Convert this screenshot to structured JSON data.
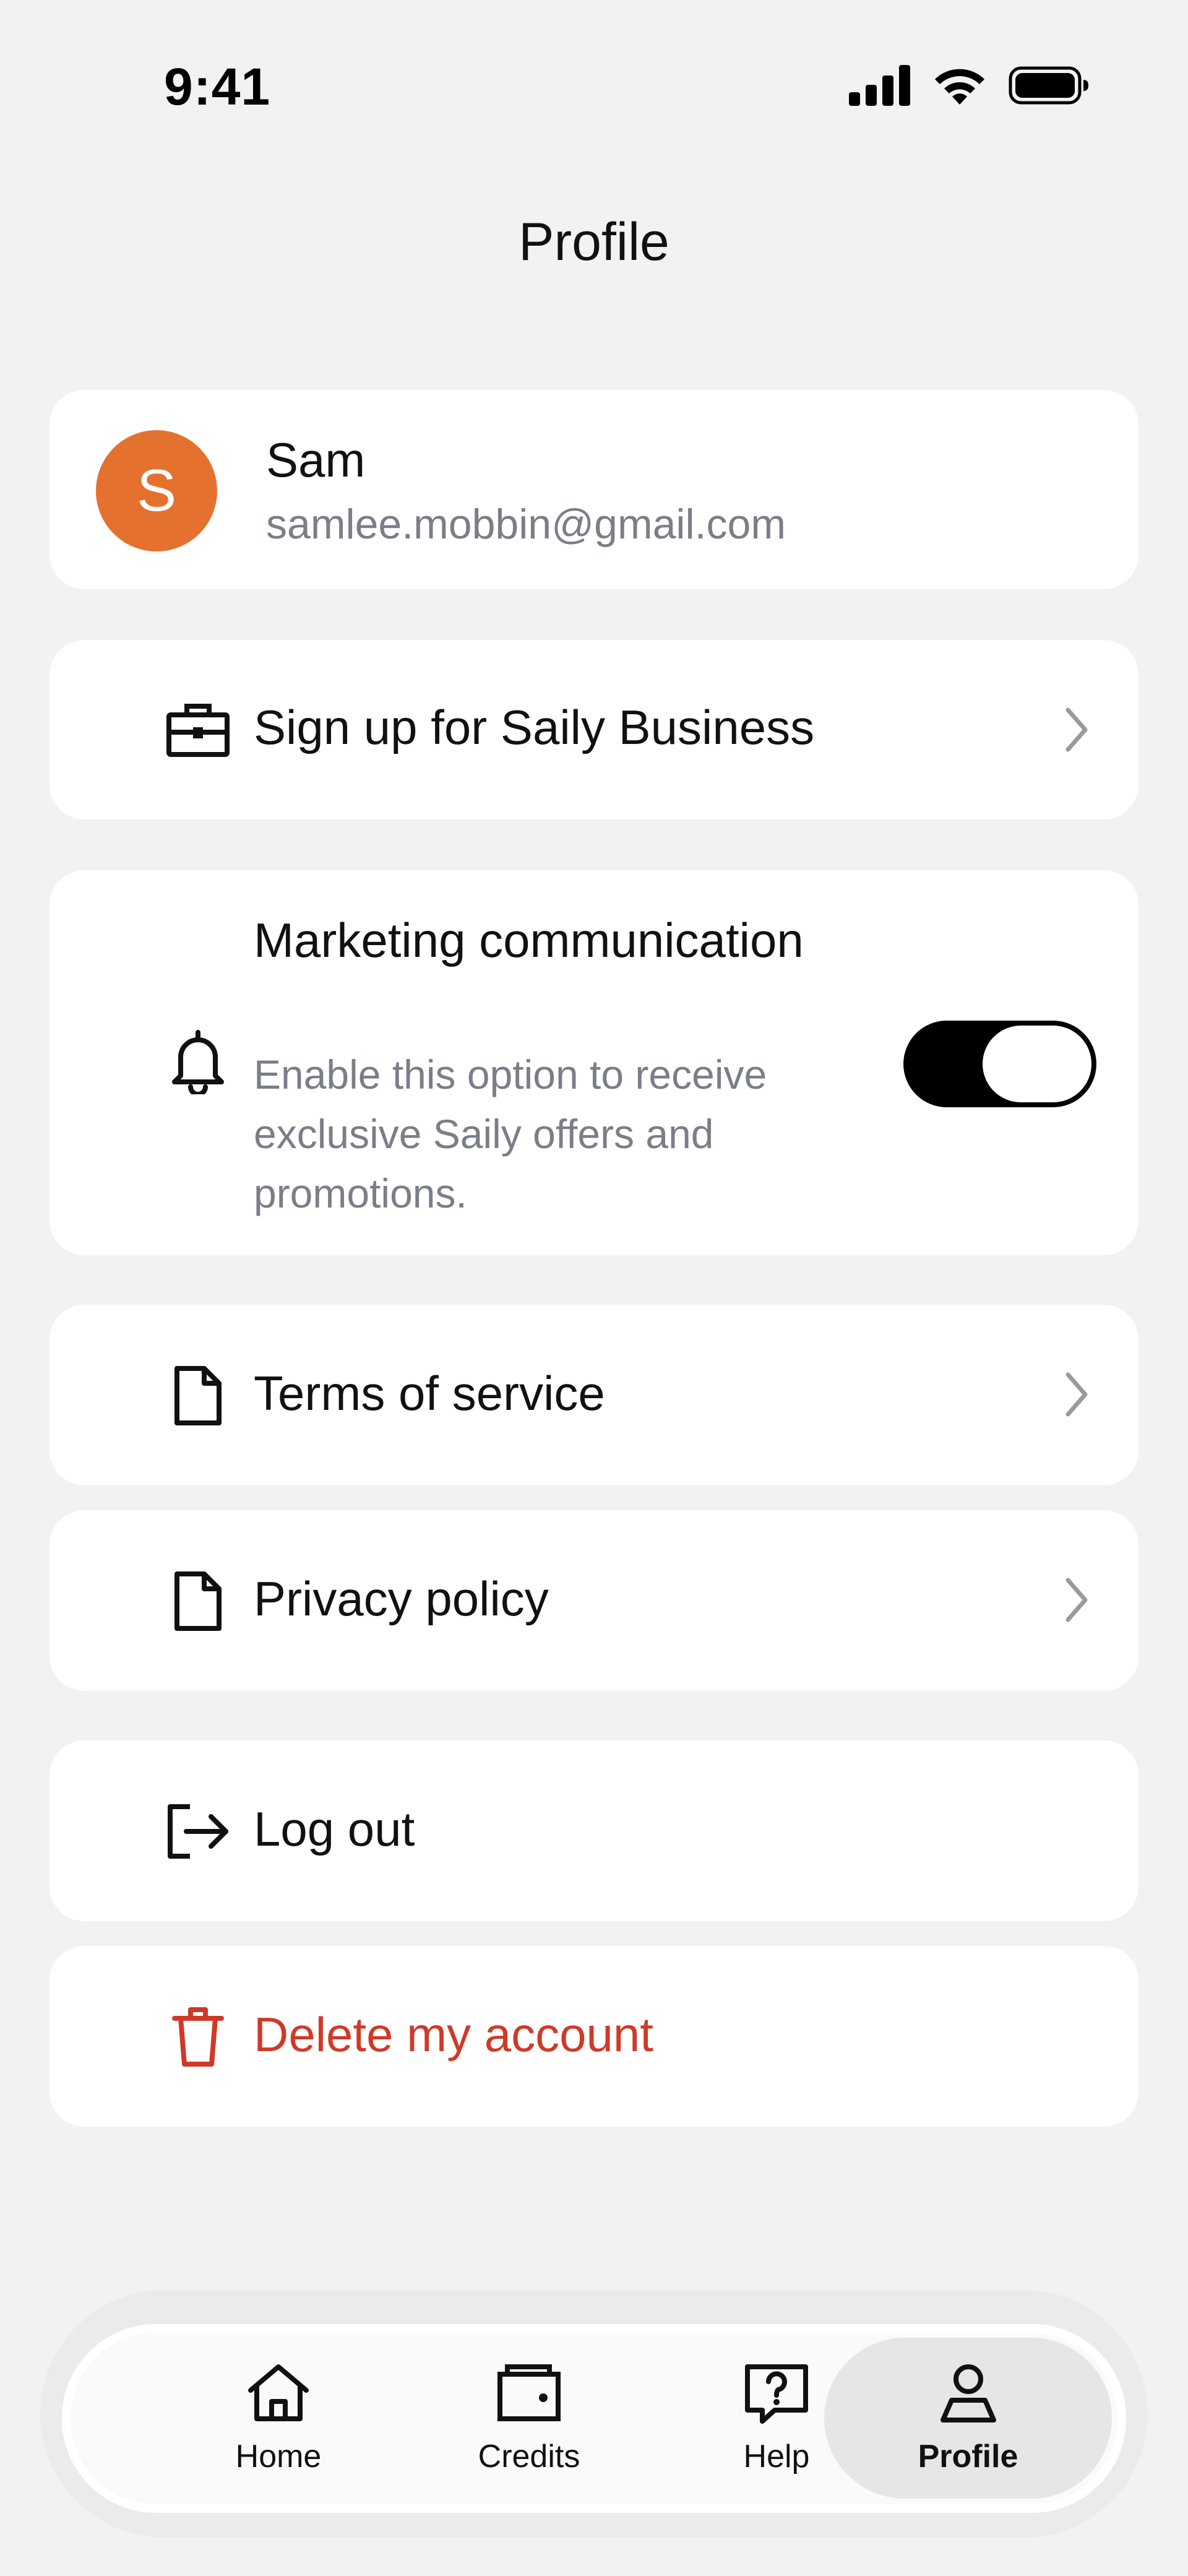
{
  "status_bar": {
    "time": "9:41"
  },
  "header": {
    "title": "Profile"
  },
  "profile": {
    "initial": "S",
    "name": "Sam",
    "email": "samlee.mobbin@gmail.com",
    "avatar_color": "#e5712f"
  },
  "menu": {
    "business": {
      "label": "Sign up for Saily Business",
      "icon": "briefcase-icon"
    },
    "marketing": {
      "title": "Marketing communication",
      "description": "Enable this option to receive exclusive Saily offers and promotions.",
      "enabled": true,
      "icon": "bell-icon"
    },
    "terms": {
      "label": "Terms of service",
      "icon": "document-icon"
    },
    "privacy": {
      "label": "Privacy policy",
      "icon": "document-icon"
    },
    "logout": {
      "label": "Log out",
      "icon": "logout-icon"
    },
    "delete": {
      "label": "Delete my account",
      "icon": "trash-icon",
      "color": "#cf3a28"
    }
  },
  "tabbar": {
    "tabs": [
      {
        "label": "Home",
        "icon": "home-icon"
      },
      {
        "label": "Credits",
        "icon": "wallet-icon"
      },
      {
        "label": "Help",
        "icon": "help-icon"
      },
      {
        "label": "Profile",
        "icon": "person-icon",
        "active": true
      }
    ]
  }
}
